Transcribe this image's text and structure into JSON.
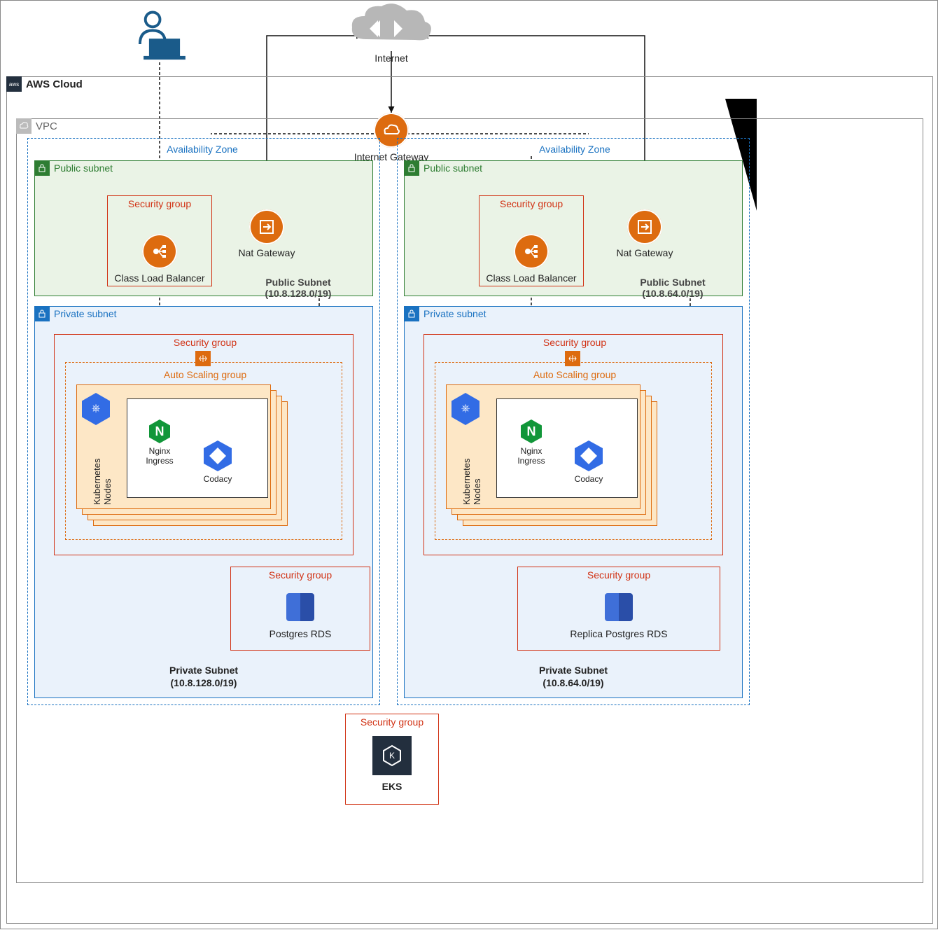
{
  "internet": {
    "label": "Internet"
  },
  "cloud": {
    "label": "AWS Cloud",
    "tag": "aws"
  },
  "vpc": {
    "label": "VPC"
  },
  "igw": {
    "label": "Internet Gateway"
  },
  "az_label": "Availability Zone",
  "zones": [
    {
      "side": "left",
      "public": {
        "badge": "Public subnet",
        "title": "Public Subnet",
        "cidr": "(10.8.128.0/19)",
        "sg_label": "Security group",
        "clb": "Class Load Balancer",
        "nat": "Nat Gateway"
      },
      "private": {
        "badge": "Private subnet",
        "title": "Private Subnet",
        "cidr": "(10.8.128.0/19)",
        "sg_label": "Security group",
        "asg_label": "Auto Scaling group",
        "k8_label": "Kubernetes\nNodes",
        "nginx": "Nginx\nIngress",
        "codacy": "Codacy",
        "rds_sg": "Security group",
        "rds": "Postgres RDS"
      }
    },
    {
      "side": "right",
      "public": {
        "badge": "Public subnet",
        "title": "Public Subnet",
        "cidr": "(10.8.64.0/19)",
        "sg_label": "Security group",
        "clb": "Class Load Balancer",
        "nat": "Nat Gateway"
      },
      "private": {
        "badge": "Private subnet",
        "title": "Private Subnet",
        "cidr": "(10.8.64.0/19)",
        "sg_label": "Security group",
        "asg_label": "Auto Scaling group",
        "k8_label": "Kubernetes\nNodes",
        "nginx": "Nginx\nIngress",
        "codacy": "Codacy",
        "rds_sg": "Security group",
        "rds": "Replica Postgres RDS"
      }
    }
  ],
  "eks": {
    "sg_label": "Security group",
    "label": "EKS"
  }
}
